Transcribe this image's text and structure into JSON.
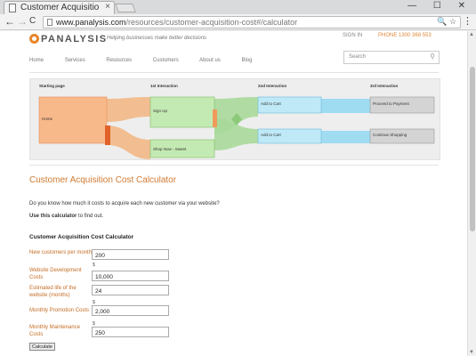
{
  "browser": {
    "tab_title": "Customer Acquisitio",
    "tab_close": "×",
    "window_controls": "— ☐ ✕",
    "back": "←",
    "forward": "→",
    "reload": "C",
    "url_domain": "www.panalysis.com",
    "url_path": "/resources/customer-acquisition-cost#/calculator",
    "url_right": "🔍 ☆",
    "menu": "⋮"
  },
  "header": {
    "logo_text": "PANALYSIS",
    "tagline": "Helping businesses make better decisions",
    "sign_in": "SIGN IN",
    "phone": "PHONE 1300 368 553",
    "nav": [
      "Home",
      "Services",
      "Resources",
      "Customers",
      "About us",
      "Blog"
    ],
    "search_placeholder": "Search"
  },
  "flow": {
    "columns": [
      "Starting page",
      "1st Interaction",
      "2nd Interaction",
      "3rd Interaction"
    ],
    "nodes": {
      "home": "Home",
      "sign_up": "Sign Up",
      "shop_now": "Shop Now - Sweet",
      "add_to_cart_1": "Add to Cart",
      "add_to_cart_2": "Add to Cart",
      "proceed": "Proceed to Payment",
      "continue": "Continue Shopping"
    }
  },
  "calculator": {
    "title": "Customer Acquisition Cost Calculator",
    "intro": "Do you know how much it costs to acquire each new customer via your website?",
    "use_bold": "Use this calculator",
    "use_rest": " to find out.",
    "form_heading": "Customer Acquisition Cost Calculator",
    "currency": "$",
    "fields": [
      {
        "label": "New customers per month",
        "value": "200"
      },
      {
        "label": "Website Development Costs",
        "value": "10,000"
      },
      {
        "label": "Estimated life of the website (months)",
        "value": "24"
      },
      {
        "label": "Monthly Promotion Costs",
        "value": "2,000"
      },
      {
        "label": "Monthly Maintenance Costs",
        "value": "250"
      }
    ],
    "button": "Calculate"
  },
  "colors": {
    "accent": "#d07b32",
    "orange_node": "#f7b88a",
    "green_node": "#c4eab3",
    "blue_node": "#bfe9f7",
    "grey_node": "#d4d4d4"
  }
}
